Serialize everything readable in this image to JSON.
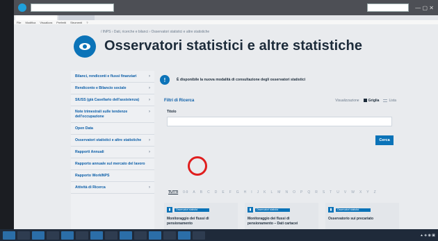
{
  "browser": {
    "menu": [
      "File",
      "Modifica",
      "Visualizza",
      "Preferiti",
      "Strumenti",
      "?"
    ]
  },
  "page": {
    "breadcrumb": "/ INPS › Dati, ricerche e bilanci › Osservatori statistici e altre statistiche",
    "title": "Osservatori statistici e altre statistiche"
  },
  "sidebar": {
    "items": [
      {
        "label": "Bilanci, rendiconti e flussi finanziari"
      },
      {
        "label": "Rendiconto e Bilancio sociale"
      },
      {
        "label": "SIUSS (già Casellario dell'assistenza)"
      },
      {
        "label": "Note trimestrali sulle tendenze dell'occupazione"
      },
      {
        "label": "Open Data"
      },
      {
        "label": "Osservatori statistici e altre statistiche"
      },
      {
        "label": "Rapporti Annuali"
      },
      {
        "label": "Rapporto annuale sul mercato del lavoro"
      },
      {
        "label": "Rapporto WorkINPS"
      },
      {
        "label": "Attività di Ricerca"
      }
    ]
  },
  "main": {
    "notice": "È disponibile la nuova modalità di consultazione degli osservatori statistici",
    "filters_title": "Filtri di Ricerca",
    "view": {
      "label": "Visualizzazione",
      "grid": "Griglia",
      "list": "Lista"
    },
    "title_label": "Titolo",
    "search_button": "Cerca",
    "alphabet": [
      "TUTTI",
      "0-9",
      "A",
      "B",
      "C",
      "D",
      "E",
      "F",
      "G",
      "H",
      "I",
      "J",
      "K",
      "L",
      "M",
      "N",
      "O",
      "P",
      "Q",
      "R",
      "S",
      "T",
      "U",
      "V",
      "W",
      "X",
      "Y",
      "Z"
    ],
    "cards": [
      {
        "tag": "Osservatori statistici",
        "title": "Monitoraggio dei flussi di pensionamento"
      },
      {
        "tag": "Osservatori statistici",
        "title": "Monitoraggio dei flussi di pensionamento – Dati cartacei"
      },
      {
        "tag": "Osservatori statistici",
        "title": "Osservatorio sui precariato"
      }
    ]
  },
  "colors": {
    "accent": "#0b73b8",
    "highlight_circle": "#e01e1e"
  }
}
